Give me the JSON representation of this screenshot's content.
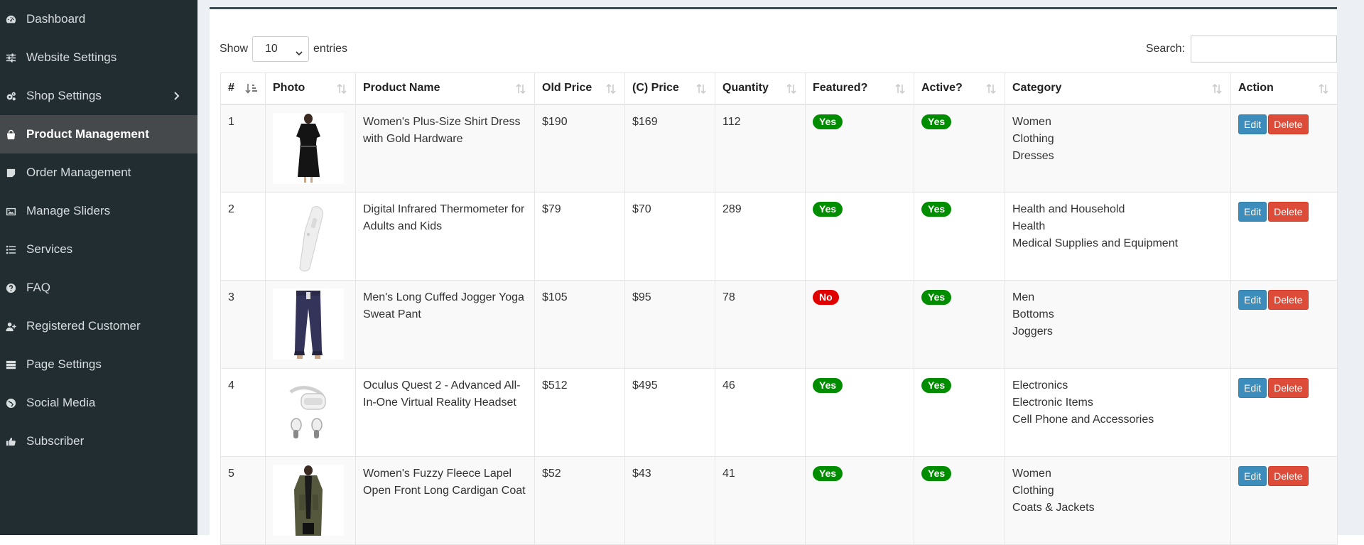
{
  "sidebar": {
    "items": [
      {
        "label": "Dashboard",
        "icon": "dashboard-icon"
      },
      {
        "label": "Website Settings",
        "icon": "sliders-icon"
      },
      {
        "label": "Shop Settings",
        "icon": "cogs-icon",
        "has_submenu": true
      },
      {
        "label": "Product Management",
        "icon": "shopping-bag-icon",
        "active": true
      },
      {
        "label": "Order Management",
        "icon": "sticky-note-icon"
      },
      {
        "label": "Manage Sliders",
        "icon": "image-icon"
      },
      {
        "label": "Services",
        "icon": "list-icon"
      },
      {
        "label": "FAQ",
        "icon": "question-circle-icon"
      },
      {
        "label": "Registered Customer",
        "icon": "user-plus-icon"
      },
      {
        "label": "Page Settings",
        "icon": "server-icon"
      },
      {
        "label": "Social Media",
        "icon": "globe-icon"
      },
      {
        "label": "Subscriber",
        "icon": "thumbs-up-icon"
      }
    ]
  },
  "controls": {
    "show_label": "Show",
    "entries_value": "10",
    "entries_label": "entries",
    "search_label": "Search:",
    "search_value": ""
  },
  "table": {
    "headers": [
      "#",
      "Photo",
      "Product Name",
      "Old Price",
      "(C) Price",
      "Quantity",
      "Featured?",
      "Active?",
      "Category",
      "Action"
    ],
    "edit_label": "Edit",
    "delete_label": "Delete",
    "rows": [
      {
        "num": "1",
        "photo": "black-dress",
        "name": "Women's Plus-Size Shirt Dress with Gold Hardware",
        "old_price": "$190",
        "price": "$169",
        "qty": "112",
        "featured": "Yes",
        "active": "Yes",
        "category": [
          "Women",
          "Clothing",
          "Dresses"
        ]
      },
      {
        "num": "2",
        "photo": "thermometer",
        "name": "Digital Infrared Thermometer for Adults and Kids",
        "old_price": "$79",
        "price": "$70",
        "qty": "289",
        "featured": "Yes",
        "active": "Yes",
        "category": [
          "Health and Household",
          "Health",
          "Medical Supplies and Equipment"
        ]
      },
      {
        "num": "3",
        "photo": "jogger-pants",
        "name": "Men's Long Cuffed Jogger Yoga Sweat Pant",
        "old_price": "$105",
        "price": "$95",
        "qty": "78",
        "featured": "No",
        "active": "Yes",
        "category": [
          "Men",
          "Bottoms",
          "Joggers"
        ]
      },
      {
        "num": "4",
        "photo": "vr-headset",
        "name": "Oculus Quest 2 - Advanced All-In-One Virtual Reality Headset",
        "old_price": "$512",
        "price": "$495",
        "qty": "46",
        "featured": "Yes",
        "active": "Yes",
        "category": [
          "Electronics",
          "Electronic Items",
          "Cell Phone and Accessories"
        ]
      },
      {
        "num": "5",
        "photo": "fleece-coat",
        "name": "Women's Fuzzy Fleece Lapel Open Front Long Cardigan Coat",
        "old_price": "$52",
        "price": "$43",
        "qty": "41",
        "featured": "Yes",
        "active": "Yes",
        "category": [
          "Women",
          "Clothing",
          "Coats & Jackets"
        ]
      }
    ]
  },
  "colors": {
    "sidebar_bg": "#222d32",
    "sidebar_active": "#45494b",
    "yes_badge": "#008d00",
    "no_badge": "#e00000",
    "edit_button": "#3c8dbc",
    "delete_button": "#dd4b39"
  }
}
